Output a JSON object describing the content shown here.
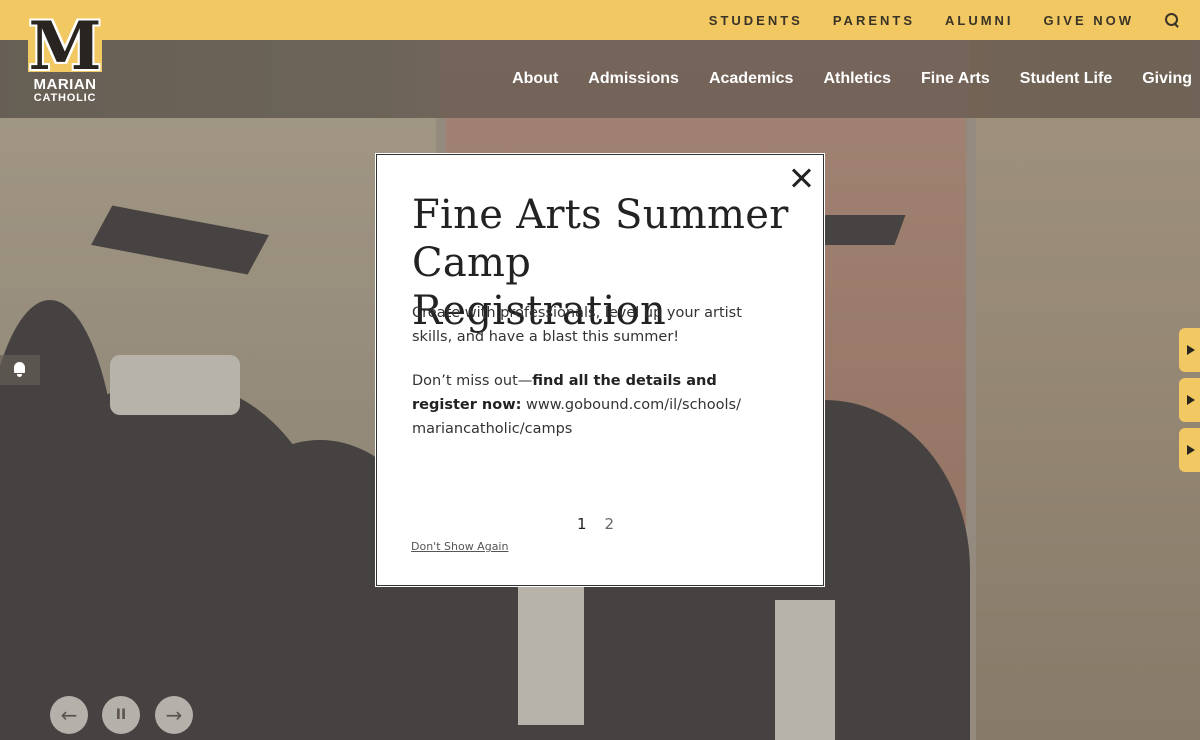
{
  "utility_nav": {
    "links": [
      "STUDENTS",
      "PARENTS",
      "ALUMNI",
      "GIVE NOW"
    ],
    "search_icon": "search-icon"
  },
  "brand": {
    "logo_letter": "M",
    "name_line1": "MARIAN",
    "name_line2": "CATHOLIC",
    "color": "#f1c862"
  },
  "main_nav": {
    "links": [
      "About",
      "Admissions",
      "Academics",
      "Athletics",
      "Fine Arts",
      "Student Life",
      "Giving"
    ]
  },
  "slider_controls": {
    "prev": "←",
    "pause": "II",
    "next": "→"
  },
  "modal": {
    "title": "Fine Arts Summer Camp Registration",
    "paragraph1": "Create with professionals, level up your artist skills, and have a blast this summer!",
    "paragraph2_lead": "Don’t miss out—",
    "paragraph2_bold": "find all the details and register now:",
    "paragraph2_link": " www.gobound.com/il/schools/ mariancatholic/camps",
    "pages": [
      "1",
      "2"
    ],
    "current_page": "1",
    "dont_show_again": "Don't Show Again",
    "close_icon": "close-icon",
    "next_arrow": "›"
  },
  "side_tabs": 3
}
